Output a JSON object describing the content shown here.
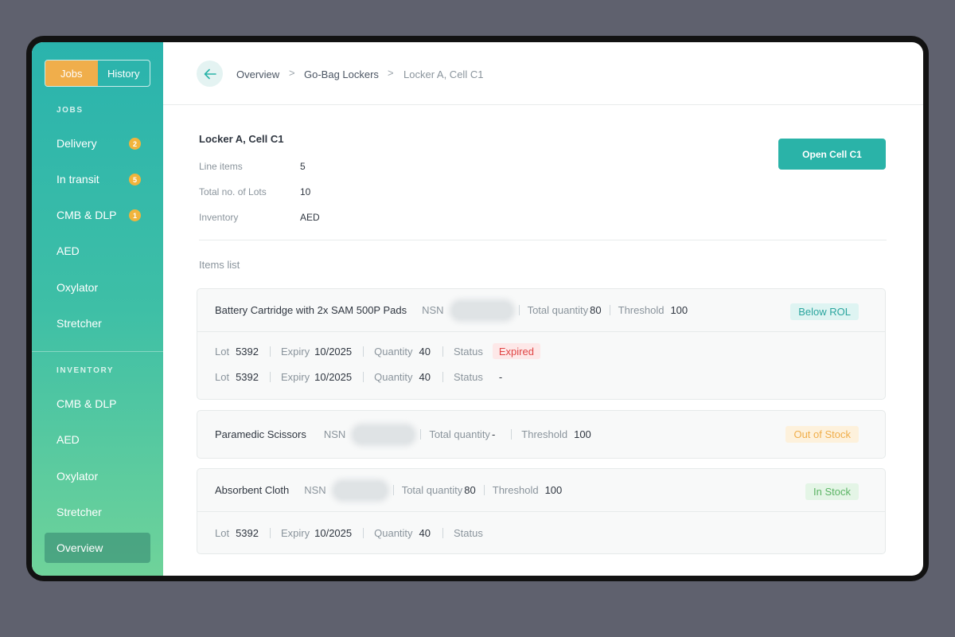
{
  "sidebar": {
    "toggle": {
      "jobs": "Jobs",
      "history": "History"
    },
    "jobs_section": "JOBS",
    "jobs_items": [
      {
        "label": "Delivery",
        "badge": "2"
      },
      {
        "label": "In transit",
        "badge": "5"
      },
      {
        "label": "CMB & DLP",
        "badge": "1"
      },
      {
        "label": "AED"
      },
      {
        "label": "Oxylator"
      },
      {
        "label": "Stretcher"
      }
    ],
    "inventory_section": "INVENTORY",
    "inventory_items": [
      {
        "label": "CMB & DLP"
      },
      {
        "label": "AED"
      },
      {
        "label": "Oxylator"
      },
      {
        "label": "Stretcher"
      },
      {
        "label": "Overview"
      }
    ]
  },
  "breadcrumb": {
    "items": [
      "Overview",
      "Go-Bag Lockers",
      "Locker A, Cell C1"
    ],
    "separator": ">"
  },
  "details": {
    "title": "Locker A, Cell C1",
    "rows": [
      {
        "label": "Line items",
        "value": "5"
      },
      {
        "label": "Total no. of Lots",
        "value": "10"
      },
      {
        "label": "Inventory",
        "value": "AED"
      }
    ]
  },
  "open_button": "Open Cell C1",
  "items_heading": "Items list",
  "labels": {
    "nsn": "NSN",
    "total_quantity": "Total quantity",
    "threshold": "Threshold",
    "lot": "Lot",
    "expiry": "Expiry",
    "quantity": "Quantity",
    "status": "Status"
  },
  "items": [
    {
      "name": "Battery Cartridge with 2x SAM 500P Pads",
      "total_quantity": "80",
      "threshold": "100",
      "status": "Below ROL",
      "lots": [
        {
          "lot": "5392",
          "expiry": "10/2025",
          "quantity": "40",
          "status": "Expired"
        },
        {
          "lot": "5392",
          "expiry": "10/2025",
          "quantity": "40",
          "status": "-"
        }
      ]
    },
    {
      "name": "Paramedic Scissors",
      "total_quantity": "-",
      "threshold": "100",
      "status": "Out of Stock"
    },
    {
      "name": "Absorbent Cloth",
      "total_quantity": "80",
      "threshold": "100",
      "status": "In Stock",
      "lots": [
        {
          "lot": "5392",
          "expiry": "10/2025",
          "quantity": "40",
          "status": ""
        }
      ]
    }
  ],
  "colors": {
    "accent": "#2ab3a8",
    "toggle_active": "#f0ae4b",
    "badge": "#f1b43c",
    "expired": "#e04545",
    "in_stock": "#5bb464"
  },
  "icons": {
    "back": "arrow-left-icon"
  }
}
